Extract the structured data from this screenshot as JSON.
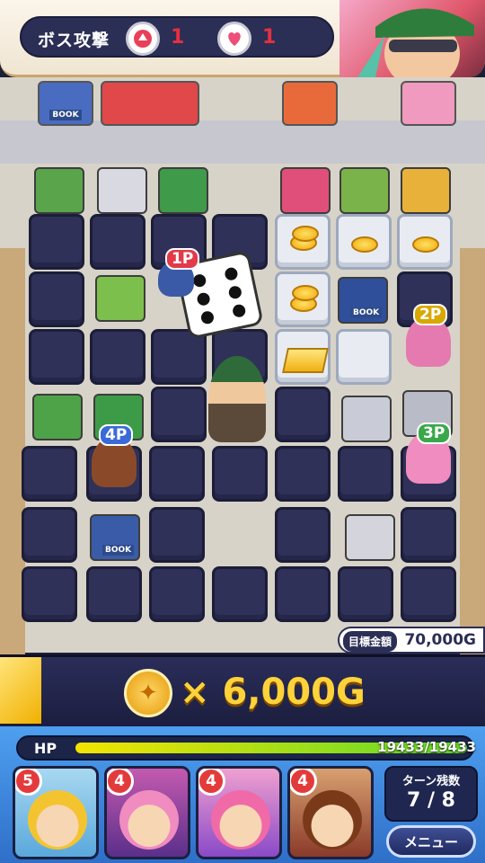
{
  "boss_attack": {
    "label": "ボス攻撃",
    "attack_icon": "fist-icon",
    "attack_value": "1",
    "heart_icon": "heart-icon",
    "heart_value": "1"
  },
  "board": {
    "store_signs": [
      "BOOK",
      "BOOK",
      "BOOK"
    ],
    "players": [
      {
        "badge": "1P",
        "color": "#e23a4a"
      },
      {
        "badge": "2P",
        "color": "#d8a800"
      },
      {
        "badge": "3P",
        "color": "#3aa84a"
      },
      {
        "badge": "4P",
        "color": "#3a6ad8"
      }
    ],
    "dice_value": 6
  },
  "goal": {
    "label": "目標金額",
    "value": "70,000G"
  },
  "reward": {
    "icon": "shuriken-coin-icon",
    "text": "× 6,000G"
  },
  "status": {
    "hp_label": "HP",
    "hp_value": "19433/19433",
    "hp_fraction": 1.0
  },
  "party": [
    {
      "level": "5"
    },
    {
      "level": "4"
    },
    {
      "level": "4"
    },
    {
      "level": "4"
    }
  ],
  "turns": {
    "title": "ターン残数",
    "value": "7 / 8"
  },
  "menu": {
    "label": "メニュー"
  }
}
